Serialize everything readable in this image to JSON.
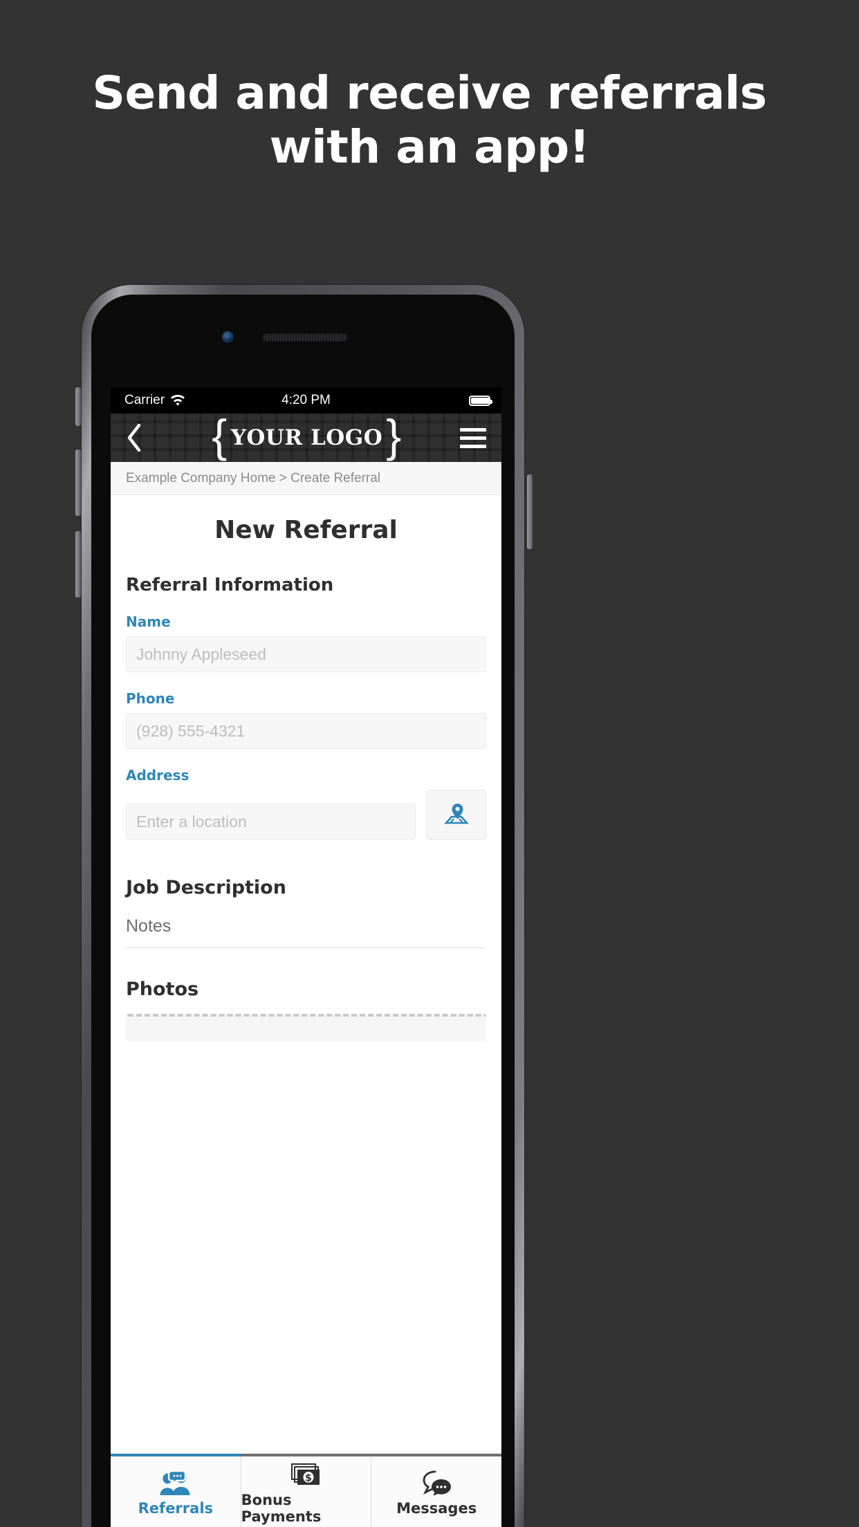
{
  "marketing": {
    "headline_lines": [
      "Send and receive referrals",
      "with an app!"
    ],
    "background_color": "#333333",
    "text_color": "#ffffff"
  },
  "status_bar": {
    "carrier": "Carrier",
    "wifi_icon": "wifi-icon",
    "time": "4:20 PM",
    "battery_icon": "battery-full-icon"
  },
  "navbar": {
    "back_icon": "chevron-left-icon",
    "logo_left_brace": "{",
    "logo_text": "YOUR LOGO",
    "logo_right_brace": "}",
    "menu_icon": "hamburger-menu-icon"
  },
  "breadcrumb": {
    "text": "Example Company Home > Create Referral"
  },
  "page": {
    "title": "New Referral",
    "section_title": "Referral Information",
    "fields": [
      {
        "label": "Name",
        "placeholder": "Johnny Appleseed",
        "value": ""
      },
      {
        "label": "Phone",
        "placeholder": "(928) 555-4321",
        "value": ""
      },
      {
        "label": "Address",
        "placeholder": "Enter a location",
        "value": ""
      }
    ],
    "map_button_icon": "map-pin-icon",
    "job_description_title": "Job Description",
    "notes_label": "Notes",
    "photos_title": "Photos"
  },
  "tabbar": {
    "items": [
      {
        "label": "Referrals",
        "icon": "two-people-chat-icon",
        "active": true
      },
      {
        "label": "Bonus Payments",
        "icon": "money-stack-icon",
        "active": false
      },
      {
        "label": "Messages",
        "icon": "chat-bubbles-icon",
        "active": false
      }
    ],
    "active_color": "#2e86b8",
    "inactive_color": "#2f2f2f"
  },
  "theme": {
    "accent": "#2e86b8",
    "navbar_bg": "#1c1c1c",
    "page_bg": "#ffffff"
  }
}
